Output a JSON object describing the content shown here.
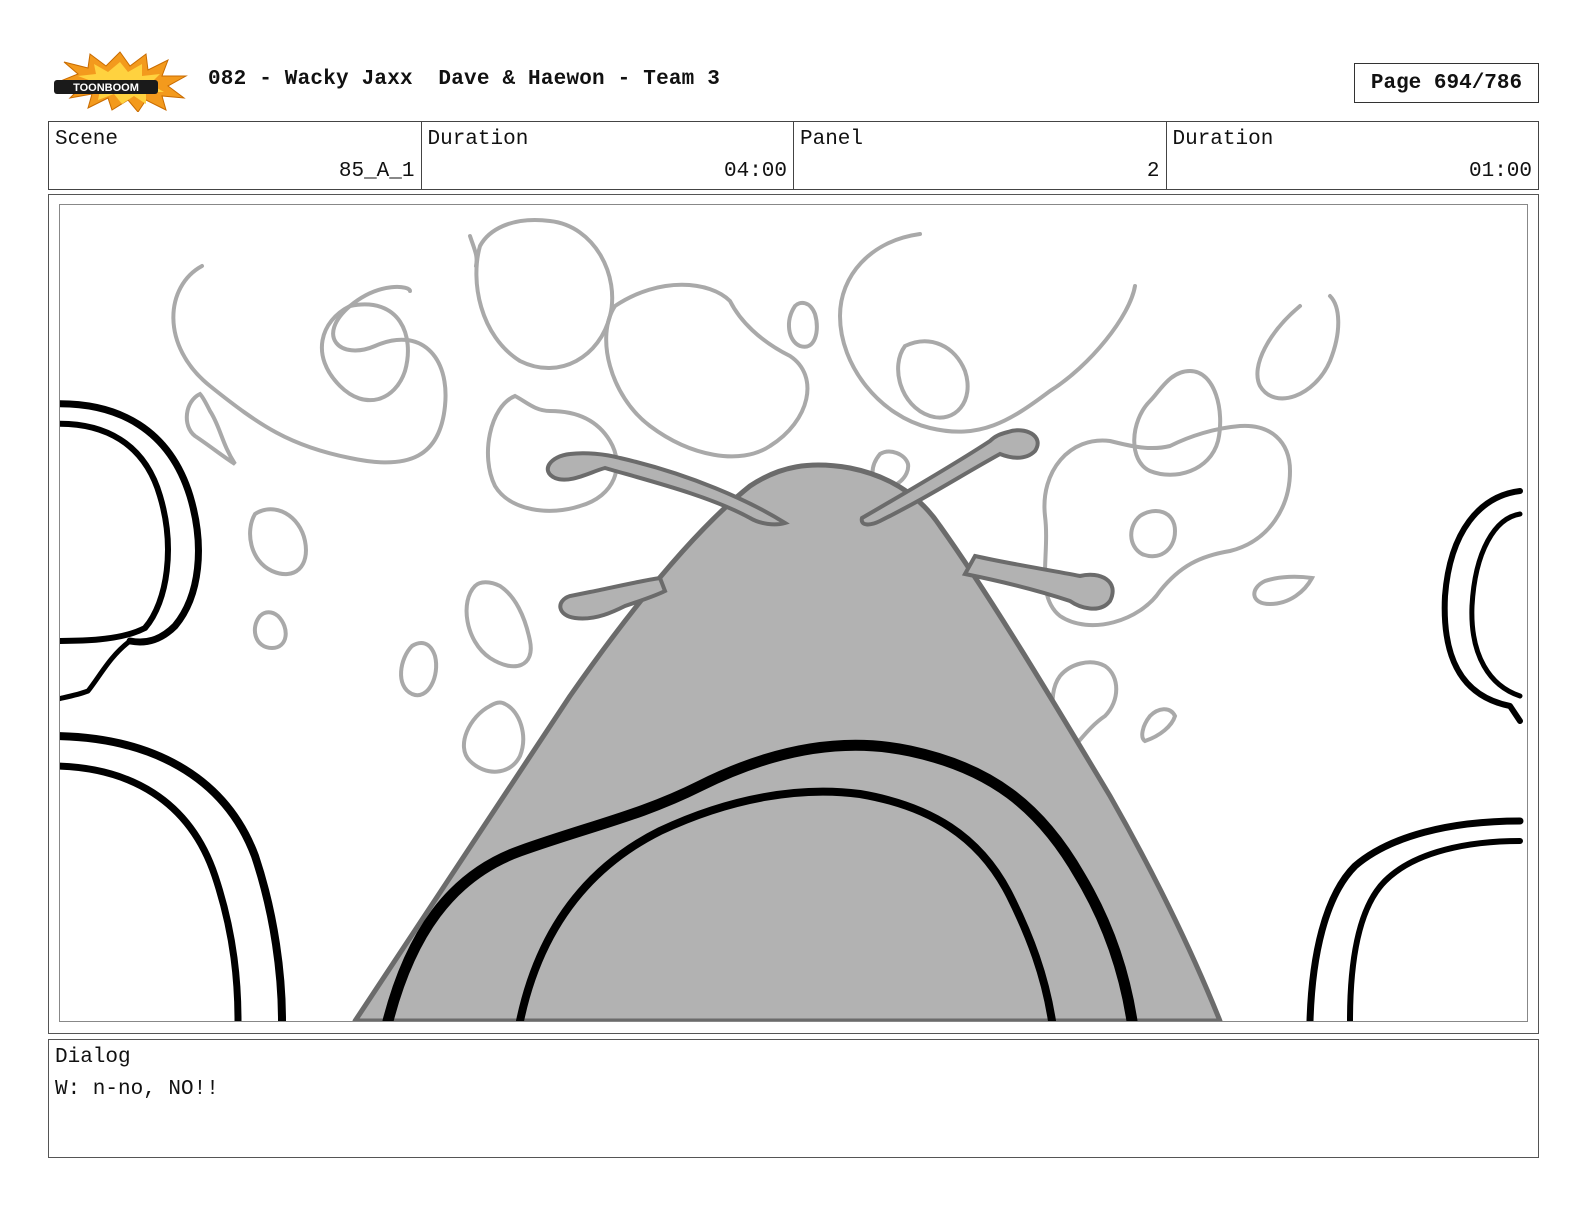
{
  "header": {
    "logo_text": "TOONBOOM",
    "title": "082 - Wacky Jaxx  Dave & Haewon - Team 3",
    "page": "Page 694/786"
  },
  "info": {
    "scene_label": "Scene",
    "scene_value": "85_A_1",
    "scene_duration_label": "Duration",
    "scene_duration_value": "04:00",
    "panel_label": "Panel",
    "panel_value": "2",
    "panel_duration_label": "Duration",
    "panel_duration_value": "01:00"
  },
  "dialog": {
    "label": "Dialog",
    "text": "W: n-no, NO!!"
  },
  "colors": {
    "logo_burst": "#f39a1d",
    "logo_burst_inner": "#ffd23f",
    "logo_band": "#1a1a1a",
    "sketch_gray": "#b2b2b2",
    "line_light": "#a9a9a9",
    "ink": "#000000"
  }
}
